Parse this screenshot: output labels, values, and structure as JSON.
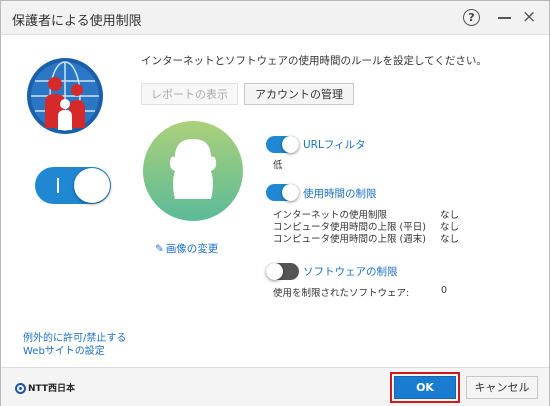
{
  "window": {
    "title": "保護者による使用制限"
  },
  "titlebar": {
    "help_glyph": "?",
    "minimize_label": "—",
    "close_glyph": "×"
  },
  "main": {
    "intro": "インターネットとソフトウェアの使用時間のルールを設定してください。",
    "report_button": "レポートの表示",
    "account_button": "アカウントの管理",
    "change_image": "画像の変更",
    "master_toggle": {
      "on": true
    }
  },
  "settings": {
    "url_filter": {
      "label": "URLフィルタ",
      "on": true,
      "value": "低"
    },
    "time_limit": {
      "label": "使用時間の制限",
      "on": true,
      "rows": [
        {
          "label": "インターネットの使用制限",
          "value": "なし"
        },
        {
          "label": "コンピュータ使用時間の上限 (平日)",
          "value": "なし"
        },
        {
          "label": "コンピュータ使用時間の上限 (週末)",
          "value": "なし"
        }
      ]
    },
    "software_limit": {
      "label": "ソフトウェアの制限",
      "on": false,
      "row_label": "使用を制限されたソフトウェア:",
      "row_value": "0"
    }
  },
  "links": {
    "website_exceptions_line1": "例外的に許可/禁止する",
    "website_exceptions_line2": "Webサイトの設定"
  },
  "footer": {
    "brand": "NTT西日本",
    "ok_button": "OK",
    "cancel_button": "キャンセル"
  },
  "colors": {
    "accent": "#1a7cd0",
    "highlight": "#d11a1a",
    "avatar_top": "#a8cf7c",
    "avatar_bottom": "#5dbb9a"
  },
  "icons": [
    "help-icon",
    "minimize-icon",
    "close-icon",
    "family-globe-icon",
    "pencil-icon",
    "ntt-logo-icon"
  ]
}
